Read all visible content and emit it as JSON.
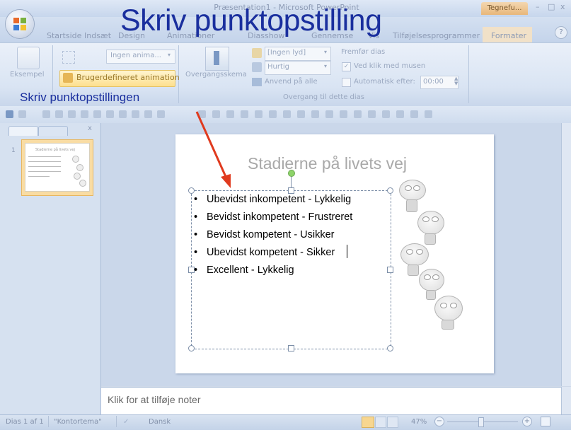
{
  "headline": "Skriv punktopstilling",
  "annotation_label": "Skriv punktopstillingen",
  "window": {
    "title": "Præsentation1 - Microsoft PowerPoint",
    "context_tab": "Tegnefu...",
    "min": "–",
    "max": "□",
    "close": "x"
  },
  "tabs": [
    "Startside",
    "Indsæt",
    "Design",
    "Animationer",
    "Diasshow",
    "Gennemse",
    "Vis",
    "Tilføjelsesprogrammer",
    "Formater"
  ],
  "ribbon": {
    "preview_label": "Eksempel",
    "animate_select": "Ingen anima...",
    "custom_animation": "Brugerdefineret animation",
    "transition_scheme": "Overgangsskema",
    "sound_select": "[Ingen lyd]",
    "speed_select": "Hurtig",
    "apply_all": "Anvend på alle",
    "advance_title": "Fremfør dias",
    "on_click": "Ved klik med musen",
    "auto_after": "Automatisk efter:",
    "auto_time": "00:00",
    "group_label": "Overgang til dette dias"
  },
  "slide": {
    "title": "Stadierne på livets vej",
    "bullets": [
      "Ubevidst inkompetent - Lykkelig",
      "Bevidst inkompetent - Frustreret",
      "Bevidst kompetent - Usikker",
      "Ubevidst kompetent - Sikker",
      "Excellent - Lykkelig"
    ]
  },
  "thumbnail": {
    "number": "1",
    "title": "Stadierne på livets vej"
  },
  "notes_placeholder": "Klik for at tilføje noter",
  "status": {
    "slide_info": "Dias 1 af 1",
    "theme": "\"Kontortema\"",
    "language": "Dansk",
    "zoom": "47%"
  },
  "colors": {
    "headline": "#1a2f9e",
    "arrow": "#e03a1e",
    "ribbon_bg": "#d9e4f3"
  }
}
